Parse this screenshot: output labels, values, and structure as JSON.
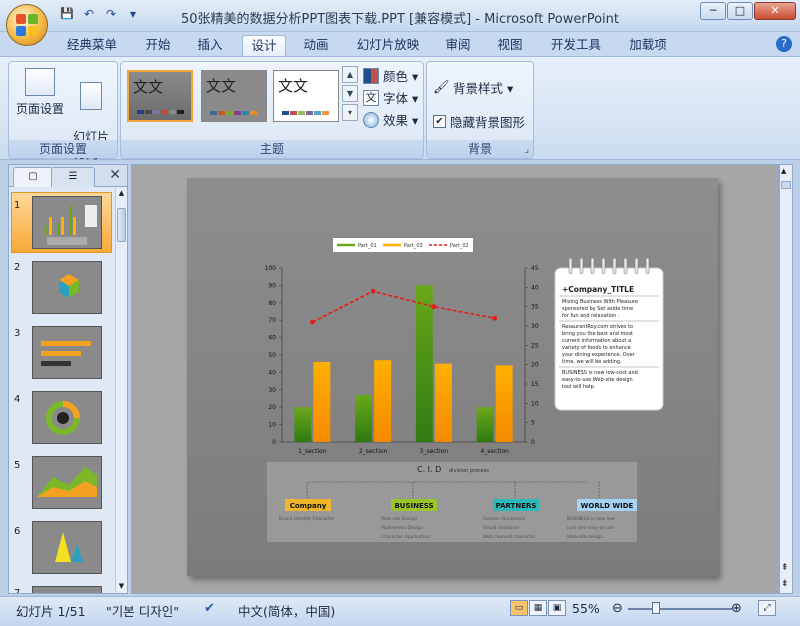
{
  "window": {
    "title": "50张精美的数据分析PPT图表下载.PPT [兼容模式] - Microsoft PowerPoint",
    "min": "─",
    "max": "□",
    "close": "✕"
  },
  "qat": {
    "save": "💾",
    "undo": "↶",
    "redo": "↷",
    "more": "▾"
  },
  "tabs": [
    "经典菜单",
    "开始",
    "插入",
    "设计",
    "动画",
    "幻灯片放映",
    "审阅",
    "视图",
    "开发工具",
    "加载项"
  ],
  "active_tab": "设计",
  "help": "?",
  "ribbon": {
    "page_setup": {
      "btn1": "页面设置",
      "btn2": "幻灯片\n方向 ▾",
      "label": "页面设置"
    },
    "themes": {
      "sample": "文文",
      "label": "主题",
      "colors": "颜色 ▾",
      "fonts": "字体 ▾",
      "effects": "效果 ▾"
    },
    "background": {
      "styles": "背景样式 ▾",
      "hide": "隐藏背景图形",
      "label": "背景"
    }
  },
  "slides_count": [
    1,
    2,
    3,
    4,
    5,
    6,
    7
  ],
  "slide": {
    "legend": [
      "Part_01",
      "Part_03",
      "Part_02"
    ],
    "ticks_left": [
      "100",
      "90",
      "80",
      "70",
      "60",
      "50",
      "40",
      "30",
      "20",
      "10",
      "0"
    ],
    "ticks_right": [
      "45",
      "40",
      "35",
      "30",
      "25",
      "20",
      "15",
      "10",
      "5",
      "0"
    ],
    "notebook_title": "+Company_TITLE",
    "notebook_lines": [
      "Mixing Business With Pleasure sponsored by Set aside time for fun and relaxation .",
      "ResaurantRoy.com strives to bring you the best and most current information about a variety of foods to enhance your dining experience. Over time, we will be adding.",
      "BUSINESS is new low-cost and easy-to-use Web-site design tool will help."
    ],
    "cid_title": "C. I. D",
    "cid_sub": "division process",
    "cid_boxes": [
      "Company",
      "BUSINESS",
      "PARTNERS",
      "WORLD WIDE"
    ],
    "cid_notes": [
      [
        "Brand identity Character"
      ],
      [
        "Web site Design",
        "Multimedia Design",
        "Character Application"
      ],
      [
        "Fashion Illustration",
        "Visual character",
        "Web clement character"
      ],
      [
        "BUSINESS is new low-",
        "cost and easy-to-use",
        "Web-site design."
      ]
    ]
  },
  "chart_data": {
    "type": "bar",
    "categories": [
      "1_section",
      "2_section",
      "3_section",
      "4_section"
    ],
    "series": [
      {
        "name": "Part_01",
        "values": [
          20,
          27,
          90,
          20
        ],
        "color": "#6aa81a"
      },
      {
        "name": "Part_03",
        "values": [
          46,
          47,
          45,
          44
        ],
        "color": "#ffb000"
      },
      {
        "name": "Part_02",
        "values": [
          31,
          39,
          35,
          32
        ],
        "axis": "right",
        "type": "line",
        "color": "#e41c1c"
      }
    ],
    "ylim": [
      0,
      100
    ],
    "y2lim": [
      0,
      45
    ],
    "legend": "top"
  },
  "status": {
    "slide": "幻灯片 1/51",
    "theme": "\"기본 디자인\"",
    "lang": "中文(简体，中国)",
    "zoom": "55%"
  }
}
